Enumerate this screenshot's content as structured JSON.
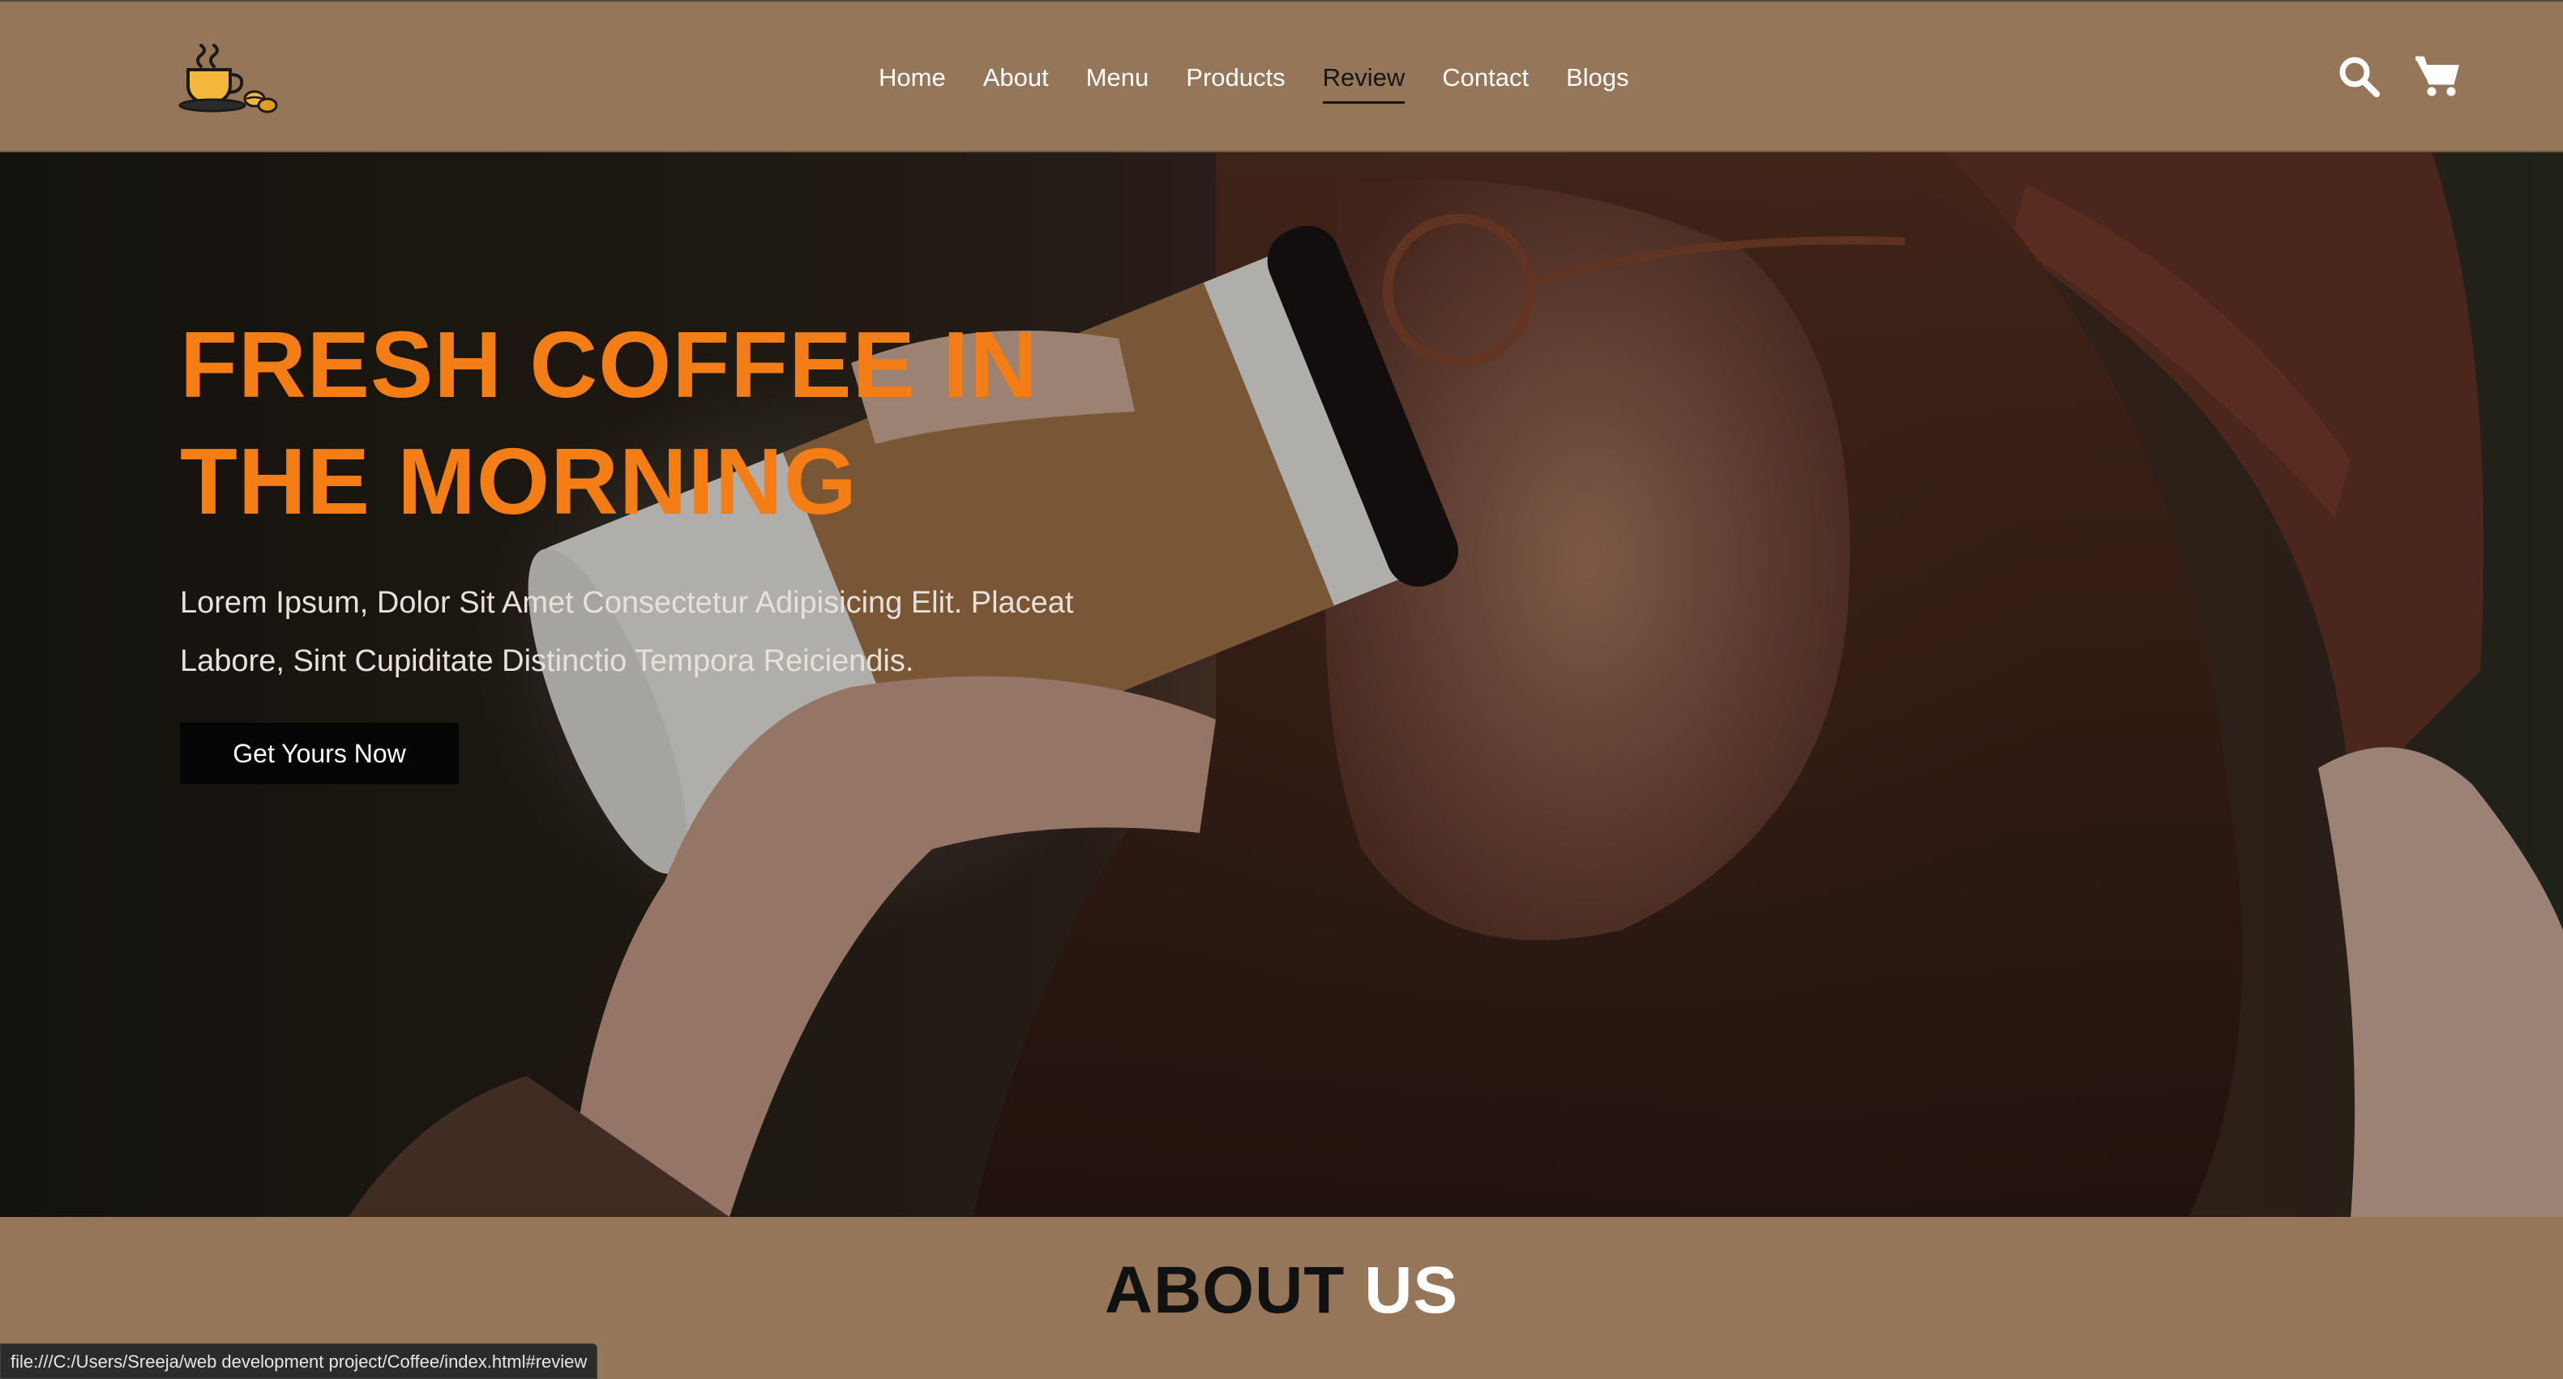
{
  "header": {
    "logo_icon": "coffee-cup-logo-icon",
    "nav": [
      {
        "label": "Home",
        "active": false
      },
      {
        "label": "About",
        "active": false
      },
      {
        "label": "Menu",
        "active": false
      },
      {
        "label": "Products",
        "active": false
      },
      {
        "label": "Review",
        "active": true
      },
      {
        "label": "Contact",
        "active": false
      },
      {
        "label": "Blogs",
        "active": false
      }
    ],
    "icons": [
      "search-icon",
      "cart-icon"
    ]
  },
  "hero": {
    "title_line1": "FRESH COFFEE IN",
    "title_line2": "THE MORNING",
    "subtitle": "Lorem Ipsum, Dolor Sit Amet Consectetur Adipisicing Elit. Placeat Labore, Sint Cupiditate Distinctio Tempora Reiciendis.",
    "button_label": "Get Yours Now"
  },
  "about": {
    "title_word1": "ABOUT",
    "title_word2": "US"
  },
  "status_bar": {
    "url": "file:///C:/Users/Sreeja/web development project/Coffee/index.html#review"
  },
  "colors": {
    "header_bg": "#957659",
    "accent_orange": "#f47e16",
    "button_bg": "#050505",
    "active_nav": "#151515"
  }
}
